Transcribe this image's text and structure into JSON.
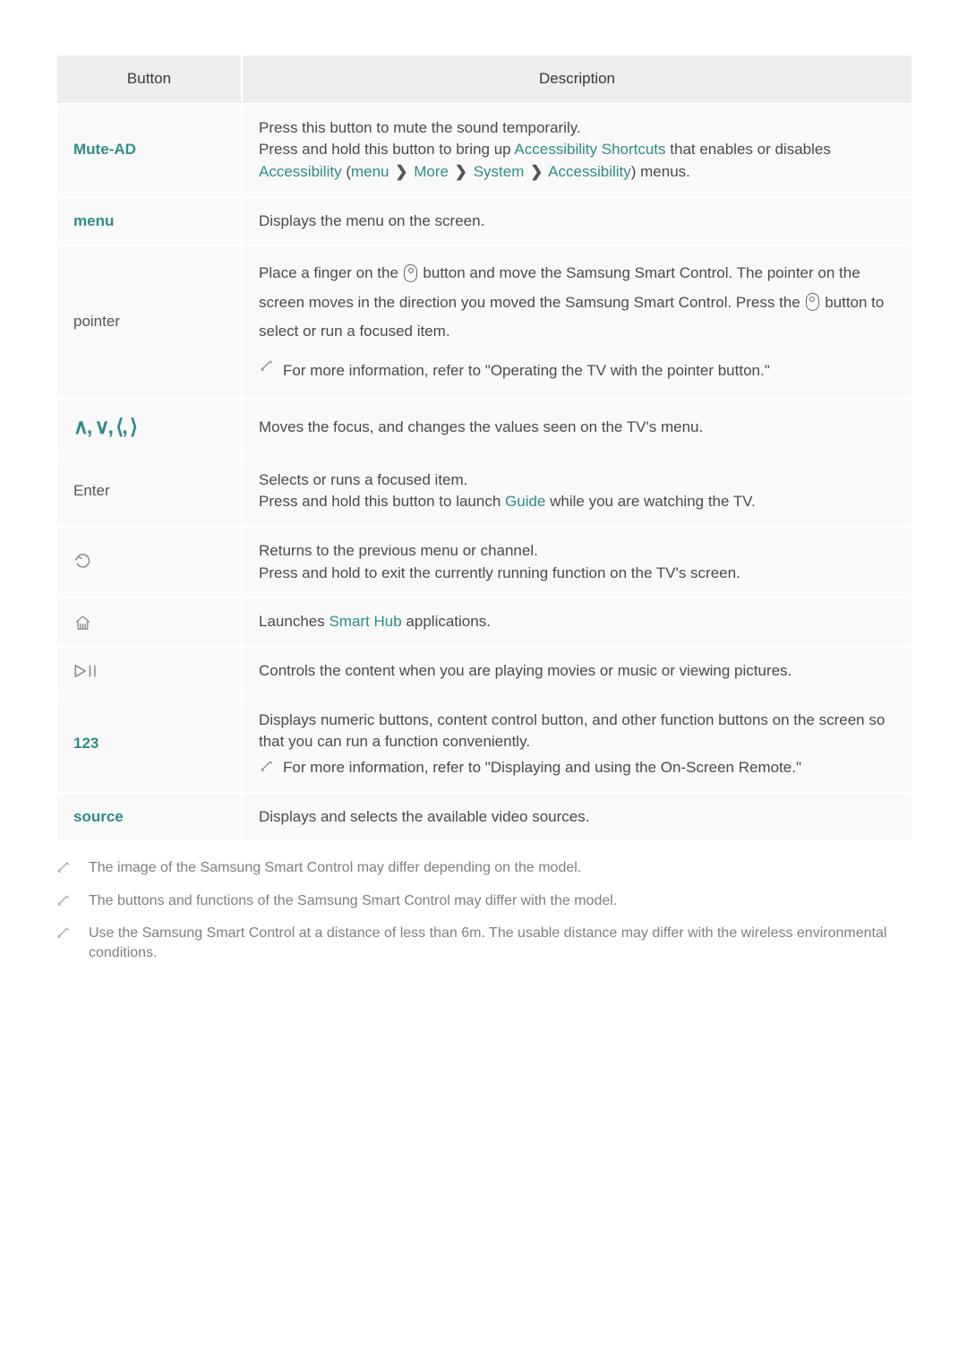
{
  "headers": {
    "button": "Button",
    "description": "Description"
  },
  "rows": {
    "muteAd": {
      "label": "Mute-AD",
      "line1": "Press this button to mute the sound temporarily.",
      "line2a": "Press and hold this button to bring up ",
      "link_accShortcuts": "Accessibility Shortcuts",
      "line2b": " that enables or disables ",
      "link_accessibility": "Accessibility",
      "line2c": " (",
      "menuWord": "menu",
      "more": "More",
      "system": "System",
      "accessibility2": "Accessibility",
      "line2end": ") menus."
    },
    "menu": {
      "label": "menu",
      "desc": "Displays the menu on the screen."
    },
    "pointer": {
      "label": "pointer",
      "l1a": "Place a finger on the ",
      "l1b": " button and move the Samsung Smart Control. The pointer on the screen moves in the direction you moved the Samsung Smart Control. Press the ",
      "l1c": " button to select or run a focused item.",
      "note": "For more information, refer to \"Operating the TV with the pointer button.\""
    },
    "arrows": {
      "symbols": "∧, ∨, ⟨, ⟩",
      "desc": "Moves the focus, and changes the values seen on the TV's menu."
    },
    "enter": {
      "label": "Enter",
      "l1": "Selects or runs a focused item.",
      "l2a": "Press and hold this button to launch ",
      "guide": "Guide",
      "l2b": " while you are watching the TV."
    },
    "return": {
      "l1": "Returns to the previous menu or channel.",
      "l2": "Press and hold to exit the currently running function on the TV's screen."
    },
    "home": {
      "l1a": "Launches ",
      "smartHub": "Smart Hub",
      "l1b": " applications."
    },
    "playpause": {
      "l1": "Controls the content when you are playing movies or music or viewing pictures."
    },
    "num": {
      "label": "123",
      "l1": "Displays numeric buttons, content control button, and other function buttons on the screen so that you can run a function conveniently.",
      "note": "For more information, refer to \"Displaying and using the On-Screen Remote.\""
    },
    "source": {
      "label": "source",
      "l1": "Displays and selects the available video sources."
    }
  },
  "notes": {
    "n1": "The image of the Samsung Smart Control may differ depending on the model.",
    "n2": "The buttons and functions of the Samsung Smart Control may differ with the model.",
    "n3": "Use the Samsung Smart Control at a distance of less than 6m. The usable distance may differ with the wireless environmental conditions."
  }
}
